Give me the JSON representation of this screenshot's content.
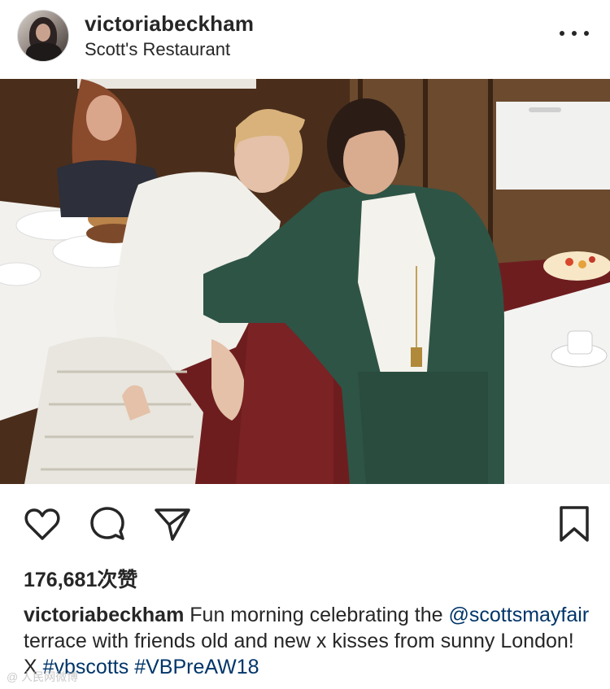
{
  "post": {
    "username": "victoriabeckham",
    "location": "Scott's Restaurant",
    "likes": "176,681次赞",
    "caption": {
      "user": "victoriabeckham",
      "text1": " Fun morning celebrating the ",
      "mention": "@scottsmayfair",
      "text2": " terrace with friends old and new x kisses from sunny London! X ",
      "tag1": "#vbscotts",
      "space": " ",
      "tag2": "#VBPreAW18"
    }
  },
  "icons": {
    "more": "more-options-icon",
    "like": "heart-icon",
    "comment": "comment-icon",
    "share": "share-icon",
    "save": "bookmark-icon"
  },
  "watermark": "@ 人民网微博",
  "colors": {
    "text": "#262626",
    "link": "#003569",
    "border": "#dbdbdb"
  }
}
